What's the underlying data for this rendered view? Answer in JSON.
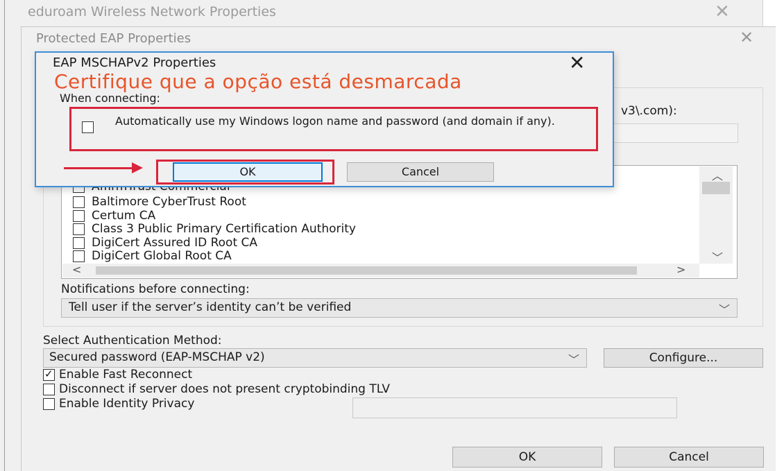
{
  "outer_window": {
    "title": "eduroam Wireless Network Properties",
    "close_glyph": "✕"
  },
  "peap_window": {
    "title": "Protected EAP Properties",
    "close_glyph": "✕",
    "connect_text_fragment": "v3\\.com):",
    "certificate_list": [
      {
        "label": "AffirmTrust Commercial",
        "checked": false
      },
      {
        "label": "Baltimore CyberTrust Root",
        "checked": false
      },
      {
        "label": "Certum CA",
        "checked": false
      },
      {
        "label": "Class 3 Public Primary Certification Authority",
        "checked": false
      },
      {
        "label": "DigiCert Assured ID Root CA",
        "checked": false
      },
      {
        "label": "DigiCert Global Root CA",
        "checked": false
      }
    ],
    "notifications_label": "Notifications before connecting:",
    "notifications_value": "Tell user if the server’s identity can’t be verified",
    "auth_method_label": "Select Authentication Method:",
    "auth_method_value": "Secured password (EAP-MSCHAP v2)",
    "configure_label": "Configure...",
    "options": [
      {
        "label": "Enable Fast Reconnect",
        "checked": true
      },
      {
        "label": "Disconnect if server does not present cryptobinding TLV",
        "checked": false
      },
      {
        "label": "Enable Identity Privacy",
        "checked": false
      }
    ],
    "ok_label": "OK",
    "cancel_label": "Cancel"
  },
  "mschap_dialog": {
    "title": "EAP MSCHAPv2 Properties",
    "close_glyph": "✕",
    "annotation": "Certifique que a opção está desmarcada",
    "when_connecting_label": "When connecting:",
    "auto_logon_label": "Automatically use my Windows logon name and password (and domain if any).",
    "auto_logon_checked": false,
    "ok_label": "OK",
    "cancel_label": "Cancel"
  },
  "scroll_glyphs": {
    "up": "︿",
    "down": "﹀",
    "left": "<",
    "right": ">",
    "dropdown": "﹀"
  },
  "colors": {
    "highlight_red": "#d9253b",
    "annotation_orange": "#e8542a",
    "focus_blue": "#0078d7",
    "dialog_border": "#3d8ed6"
  }
}
